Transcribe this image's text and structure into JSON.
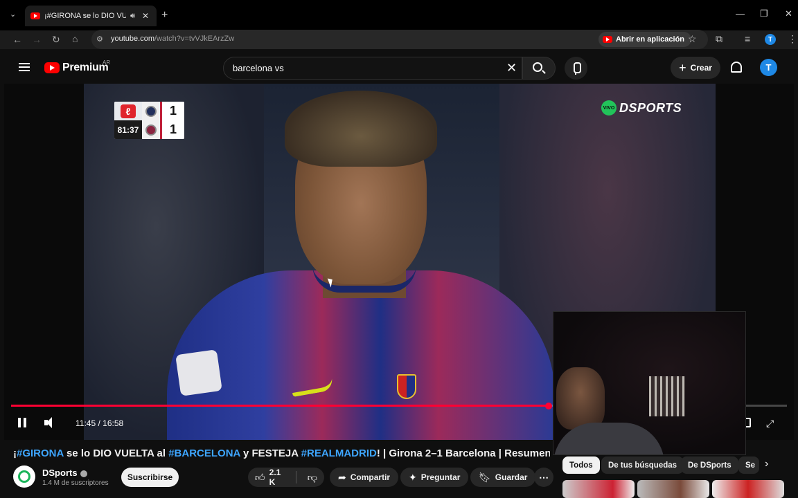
{
  "browser": {
    "tab_title": "¡#GIRONA se lo DIO VUELTA al #BARCELONA",
    "tab_audio_icon": "speaker-icon",
    "url_host": "youtube.com",
    "url_path": "/watch?v=tvVJkEArzZw",
    "open_app_label": "Abrir en aplicación",
    "profile_initial": "T"
  },
  "youtube": {
    "logo_text": "Premium",
    "region": "AR",
    "search_value": "barcelona vs",
    "create_label": "Crear",
    "avatar_initial": "T"
  },
  "player": {
    "score": {
      "time": "81:37",
      "home_score": "1",
      "away_score": "1"
    },
    "broadcaster_live": "VIVO",
    "broadcaster": "DSPORTS",
    "current_time": "11:45",
    "duration": "16:58",
    "time_display": "11:45 / 16:58",
    "progress_fraction": 0.693,
    "accent_color": "#ff0033"
  },
  "video": {
    "title_parts": [
      {
        "text": "¡",
        "tag": false
      },
      {
        "text": "#GIRONA",
        "tag": true
      },
      {
        "text": " se lo DIO VUELTA al ",
        "tag": false
      },
      {
        "text": "#BARCELONA",
        "tag": true
      },
      {
        "text": " y FESTEJA ",
        "tag": false
      },
      {
        "text": "#REALMADRID",
        "tag": true
      },
      {
        "text": "! | Girona 2–1 Barcelona | Resumen",
        "tag": false
      }
    ],
    "channel_name": "DSports",
    "subscribers": "1.4 M de suscriptores",
    "subscribe_label": "Suscribirse",
    "likes": "2.1 K",
    "share_label": "Compartir",
    "ask_label": "Preguntar",
    "save_label": "Guardar"
  },
  "sidebar": {
    "chips": [
      "Todos",
      "De tus búsquedas",
      "De DSports",
      "Se"
    ],
    "active_chip": "Todos"
  }
}
